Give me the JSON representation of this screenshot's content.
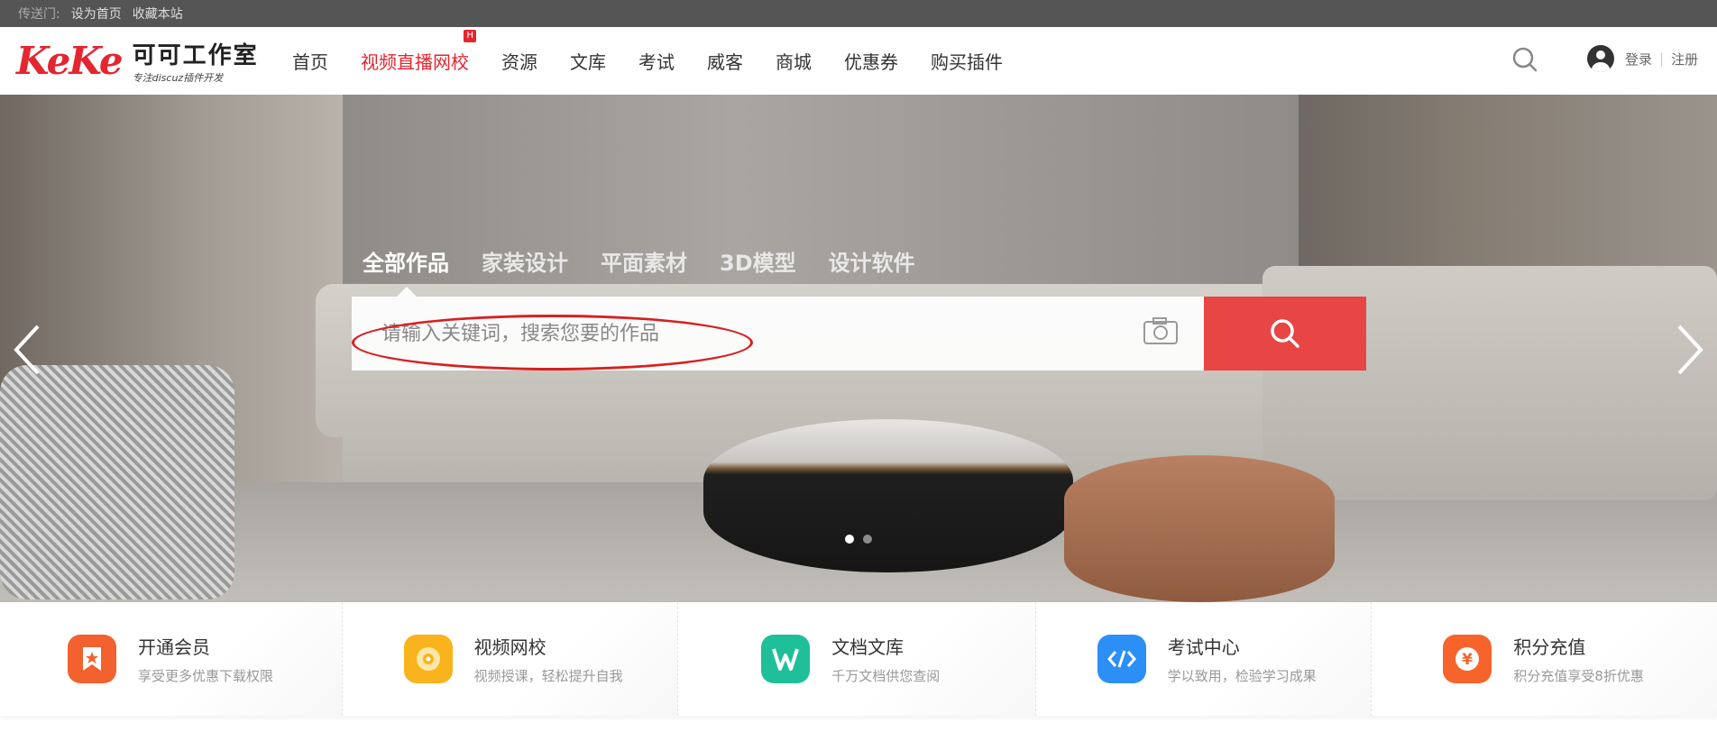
{
  "topbar": {
    "label": "传送门:",
    "links": [
      "设为首页",
      "收藏本站"
    ]
  },
  "logo": {
    "mark_left": "Ke",
    "mark_right": "Ke",
    "title": "可可工作室",
    "subtitle": "专注discuz插件开发"
  },
  "nav": {
    "items": [
      "首页",
      "视频直播网校",
      "资源",
      "文库",
      "考试",
      "威客",
      "商城",
      "优惠券",
      "购买插件"
    ],
    "active_index": 1,
    "badge": "H"
  },
  "user": {
    "login": "登录",
    "register": "注册"
  },
  "search": {
    "tabs": [
      "全部作品",
      "家装设计",
      "平面素材",
      "3D模型",
      "设计软件"
    ],
    "active_tab": 0,
    "placeholder": "请输入关键词，搜索您要的作品"
  },
  "carousel": {
    "slides": 2,
    "active": 0
  },
  "services": [
    {
      "title": "开通会员",
      "desc": "享受更多优惠下载权限",
      "icon": "vip-bookmark-icon",
      "color": "#f3612f"
    },
    {
      "title": "视频网校",
      "desc": "视频授课，轻松提升自我",
      "icon": "video-disc-icon",
      "color": "#f9b31c"
    },
    {
      "title": "文档文库",
      "desc": "千万文档供您查阅",
      "icon": "doc-w-icon",
      "color": "#1fbf9a"
    },
    {
      "title": "考试中心",
      "desc": "学以致用，检验学习成果",
      "icon": "code-icon",
      "color": "#2b8ff5"
    },
    {
      "title": "积分充值",
      "desc": "积分充值享受8折优惠",
      "icon": "yen-coin-icon",
      "color": "#f6642c"
    }
  ],
  "colors": {
    "accent": "#e3262f",
    "search_button": "#e84545",
    "topbar": "#555555"
  }
}
